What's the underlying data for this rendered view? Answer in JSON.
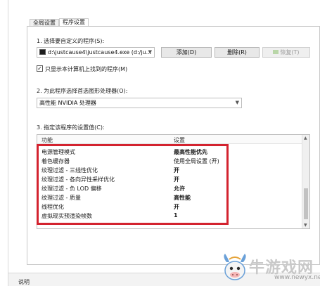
{
  "tabs": [
    {
      "label": "全局设置",
      "active": false
    },
    {
      "label": "程序设置",
      "active": true
    }
  ],
  "section1": {
    "label": "1. 选择要自定义的程序(S):",
    "program_value": "d:\\justcause4\\justcause4.exe (d:/ju...",
    "buttons": {
      "add": "添加(D)",
      "remove": "删除(R)",
      "restore": "恢复(T)"
    },
    "checkbox_label": "只显示本计算机上找到的程序(M)",
    "checkbox_checked": true
  },
  "section2": {
    "label": "2. 为此程序选择首选图形处理器(O):",
    "processor_value": "高性能 NVIDIA 处理器"
  },
  "section3": {
    "label": "3. 指定该程序的设置值(C):",
    "col_feature": "功能",
    "col_setting": "设置",
    "rows": [
      {
        "feature": "电源管理模式",
        "value": "最高性能优先",
        "bold": true
      },
      {
        "feature": "着色缓存器",
        "value": "使用全局设置 (开)",
        "bold": false
      },
      {
        "feature": "纹理过滤 - 三线性优化",
        "value": "开",
        "bold": true
      },
      {
        "feature": "纹理过滤 - 各向异性采样优化",
        "value": "开",
        "bold": true
      },
      {
        "feature": "纹理过滤 - 负 LOD 偏移",
        "value": "允许",
        "bold": true
      },
      {
        "feature": "纹理过滤 - 质量",
        "value": "高性能",
        "bold": true
      },
      {
        "feature": "线程优化",
        "value": "开",
        "bold": true
      },
      {
        "feature": "虚拟现实预渲染帧数",
        "value": "1",
        "bold": true
      }
    ]
  },
  "footer": {
    "label": "说明"
  },
  "watermark": {
    "text": "牛游戏网",
    "url": "www.newyx.net"
  },
  "colors": {
    "highlight": "#d3232f",
    "panel_border": "#c9c9c9"
  }
}
